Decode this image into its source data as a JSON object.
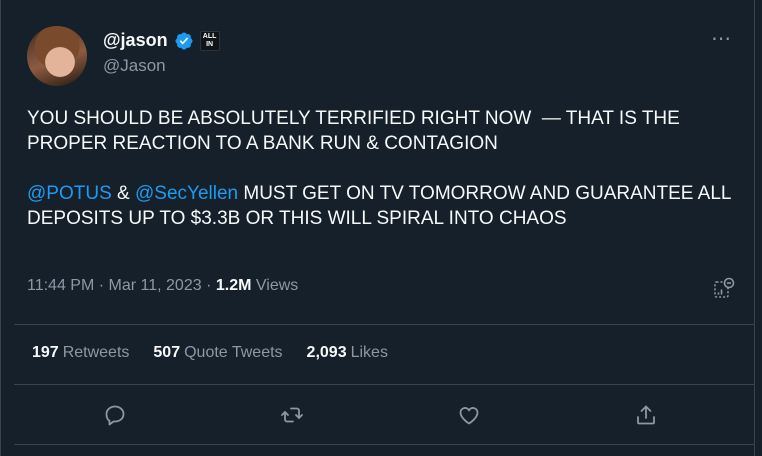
{
  "author": {
    "display_name": "@jason",
    "handle": "@Jason",
    "affiliation_badge": "ALL IN"
  },
  "tweet": {
    "line1": "YOU SHOULD BE ABSOLUTELY TERRIFIED RIGHT NOW  — THAT IS THE PROPER REACTION TO A BANK RUN & CONTAGION",
    "mention1": "@POTUS",
    "joiner": " & ",
    "mention2": "@SecYellen",
    "line2_rest": " MUST GET ON TV TOMORROW AND GUARANTEE ALL DEPOSITS UP TO $3.3B OR THIS WILL SPIRAL INTO CHAOS"
  },
  "meta": {
    "time": "11:44 PM",
    "date": "Mar 11, 2023",
    "views_count": "1.2M",
    "views_label": "Views"
  },
  "stats": {
    "retweets_count": "197",
    "retweets_label": "Retweets",
    "quotes_count": "507",
    "quotes_label": "Quote Tweets",
    "likes_count": "2,093",
    "likes_label": "Likes"
  },
  "icons": {
    "verified": "verified-badge-icon",
    "more": "more-icon",
    "analytics": "analytics-icon",
    "reply": "reply-icon",
    "retweet": "retweet-icon",
    "like": "like-icon",
    "share": "share-icon"
  },
  "colors": {
    "background": "#15202b",
    "accent": "#1d9bf0",
    "secondary_text": "#8b98a5",
    "divider": "#38444d"
  }
}
